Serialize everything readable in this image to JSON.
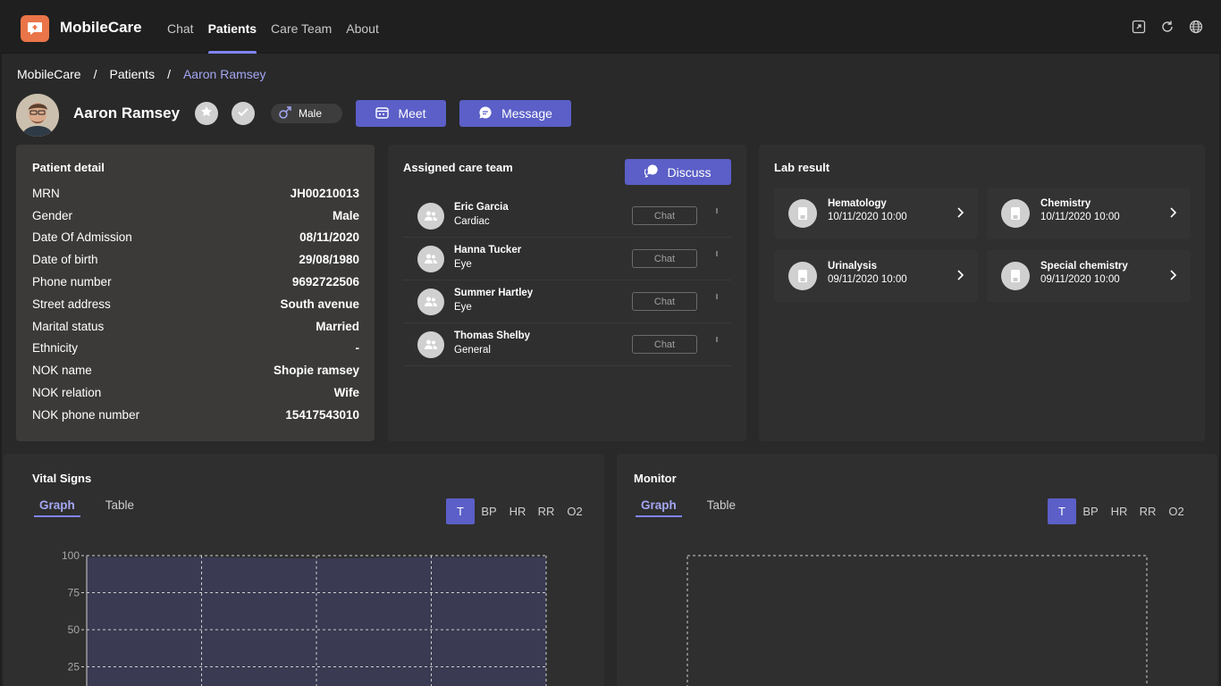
{
  "app": {
    "name": "MobileCare",
    "brand_color": "#e97548",
    "accent": "#5b5fc7"
  },
  "nav": [
    {
      "label": "Chat"
    },
    {
      "label": "Patients",
      "active": true
    },
    {
      "label": "Care Team"
    },
    {
      "label": "About"
    }
  ],
  "top_icons": [
    "popout-icon",
    "refresh-icon",
    "globe-icon"
  ],
  "breadcrumb": {
    "root": "MobileCare",
    "section": "Patients",
    "current": "Aaron Ramsey",
    "sep": "/"
  },
  "patient": {
    "name": "Aaron Ramsey",
    "gender": "Male",
    "meet_label": "Meet",
    "message_label": "Message"
  },
  "patient_detail": {
    "title": "Patient detail",
    "rows": [
      {
        "k": "MRN",
        "v": "JH00210013"
      },
      {
        "k": "Gender",
        "v": "Male"
      },
      {
        "k": "Date Of Admission",
        "v": "08/11/2020"
      },
      {
        "k": "Date of birth",
        "v": "29/08/1980"
      },
      {
        "k": "Phone number",
        "v": "9692722506"
      },
      {
        "k": "Street address",
        "v": "South avenue"
      },
      {
        "k": "Marital status",
        "v": "Married"
      },
      {
        "k": "Ethnicity",
        "v": "-"
      },
      {
        "k": "NOK name",
        "v": "Shopie ramsey"
      },
      {
        "k": "NOK relation",
        "v": "Wife"
      },
      {
        "k": "NOK phone number",
        "v": "15417543010"
      }
    ]
  },
  "care_team": {
    "title": "Assigned care team",
    "discuss_label": "Discuss",
    "chat_label": "Chat",
    "members": [
      {
        "name": "Eric Garcia",
        "role": "Cardiac"
      },
      {
        "name": "Hanna Tucker",
        "role": "Eye"
      },
      {
        "name": "Summer Hartley",
        "role": "Eye"
      },
      {
        "name": "Thomas Shelby",
        "role": "General"
      }
    ]
  },
  "lab_result": {
    "title": "Lab result",
    "items": [
      {
        "name": "Hematology",
        "date": "10/11/2020 10:00"
      },
      {
        "name": "Chemistry",
        "date": "10/11/2020 10:00"
      },
      {
        "name": "Urinalysis",
        "date": "09/11/2020 10:00"
      },
      {
        "name": "Special chemistry",
        "date": "09/11/2020 10:00"
      }
    ]
  },
  "vital_signs": {
    "title": "Vital Signs",
    "tabs": [
      "Graph",
      "Table"
    ],
    "metrics": [
      "T",
      "BP",
      "HR",
      "RR",
      "O2"
    ]
  },
  "monitor": {
    "title": "Monitor",
    "tabs": [
      "Graph",
      "Table"
    ],
    "metrics": [
      "T",
      "BP",
      "HR",
      "RR",
      "O2"
    ]
  },
  "chart_data": [
    {
      "type": "area",
      "title": "",
      "xlabel": "",
      "ylabel": "",
      "y_ticks": [
        "100",
        "75",
        "50",
        "25"
      ],
      "ylim": [
        0,
        100
      ],
      "x": [
        0,
        1,
        2,
        3,
        4
      ],
      "series": [
        {
          "values": [
            99,
            99,
            98,
            99,
            99
          ]
        }
      ],
      "grid": true,
      "fill_color": "#3a3a52"
    },
    {
      "type": "line",
      "title": "",
      "xlabel": "",
      "ylabel": "",
      "series": [],
      "grid": true
    }
  ]
}
